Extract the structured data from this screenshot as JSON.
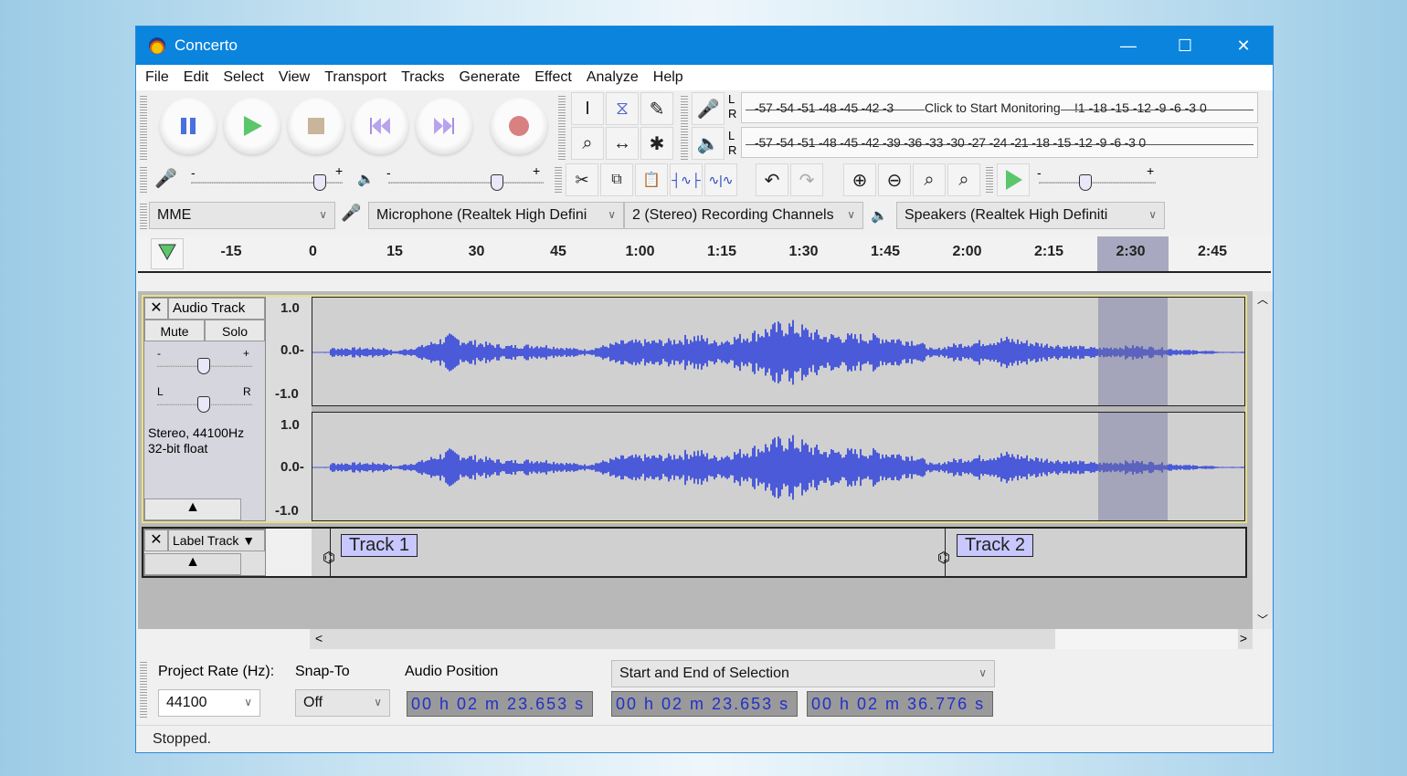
{
  "window": {
    "title": "Concerto",
    "minimize": "—",
    "maximize": "☐",
    "close": "✕"
  },
  "menu": [
    "File",
    "Edit",
    "Select",
    "View",
    "Transport",
    "Tracks",
    "Generate",
    "Effect",
    "Analyze",
    "Help"
  ],
  "transport": [
    "pause",
    "play",
    "stop",
    "skip-to-start",
    "skip-to-end",
    "record"
  ],
  "tools": {
    "selection": "I",
    "envelope": "⧖",
    "draw": "✎",
    "zoom": "⌕",
    "timeshift": "↔",
    "multi": "✱"
  },
  "meters": {
    "record_ticks": "-57 -54 -51 -48 -45 -42 -3",
    "record_tooltip": "Click to Start Monitoring",
    "record_ticks_right": "!1 -18 -15 -12  -9  -6  -3  0",
    "play_ticks": "-57 -54 -51 -48 -45 -42 -39 -36 -33 -30 -27 -24 -21 -18 -15 -12  -9  -6  -3  0",
    "L": "L",
    "R": "R"
  },
  "mixer": {
    "minus": "-",
    "plus": "+",
    "record_volume": 0.85,
    "playback_volume": 0.7,
    "play_speed": 0.4
  },
  "device": {
    "host": "MME",
    "mic": "Microphone (Realtek High Defini",
    "channels": "2 (Stereo) Recording Channels",
    "speakers": "Speakers (Realtek High Definiti"
  },
  "ruler": {
    "ticks": [
      "-15",
      "0",
      "15",
      "30",
      "45",
      "1:00",
      "1:15",
      "1:30",
      "1:45",
      "2:00",
      "2:15",
      "2:30",
      "2:45"
    ]
  },
  "audio_track": {
    "name": "Audio Track",
    "mute": "Mute",
    "solo": "Solo",
    "gain_min": "-",
    "gain_max": "+",
    "pan_left": "L",
    "pan_right": "R",
    "info_line1": "Stereo, 44100Hz",
    "info_line2": "32-bit float",
    "scale_top": "1.0",
    "scale_mid": "0.0-",
    "scale_bottom": "-1.0",
    "gain": 0.5,
    "pan": 0.5
  },
  "label_track": {
    "name": "Label Track",
    "labels": [
      "Track 1",
      "Track 2"
    ]
  },
  "selection_toolbar": {
    "project_rate_label": "Project Rate (Hz):",
    "project_rate": "44100",
    "snap_label": "Snap-To",
    "snap_value": "Off",
    "audio_position_label": "Audio Position",
    "audio_position": "00 h 02 m 23.653 s",
    "selection_mode": "Start and End of Selection",
    "selection_start": "00 h 02 m 23.653 s",
    "selection_end": "00 h 02 m 36.776 s"
  },
  "status": "Stopped."
}
